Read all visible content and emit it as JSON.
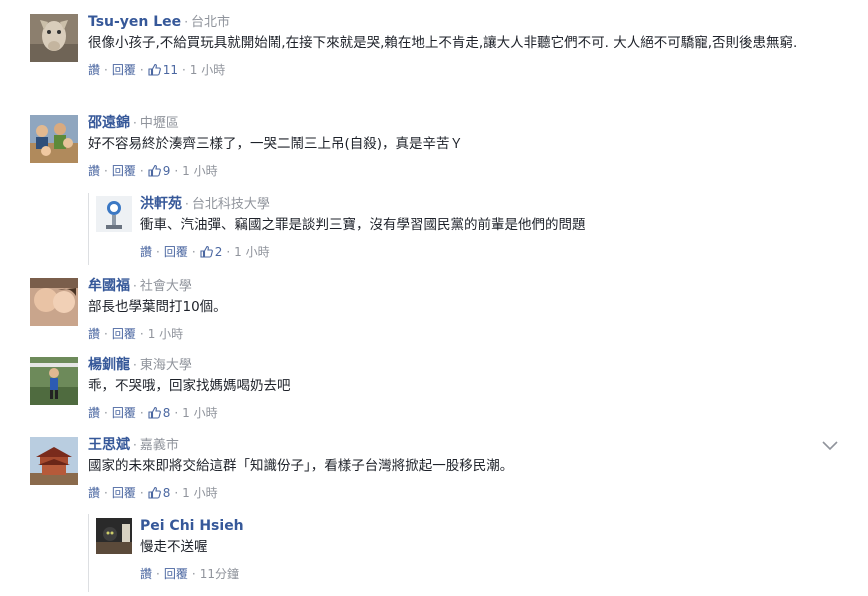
{
  "actions": {
    "like": "讚",
    "reply": "回覆",
    "separator": "·"
  },
  "comments": [
    {
      "name": "Tsu-yen Lee",
      "affiliation": "台北市",
      "text": "很像小孩子,不給買玩具就開始鬧,在接下來就是哭,賴在地上不肯走,讓大人非聽它們不可. 大人絕不可驕寵,否則後患無窮.",
      "likes": "11",
      "time": "1 小時"
    },
    {
      "name": "邵遠錦",
      "affiliation": "中壢區",
      "text": "好不容易終於湊齊三樣了，一哭二鬧三上吊(自殺)，真是辛苦Ｙ",
      "likes": "9",
      "time": "1 小時"
    },
    {
      "name": "洪軒苑",
      "affiliation": "台北科技大學",
      "text": "衝車、汽油彈、竊國之罪是談判三寶，沒有學習國民黨的前輩是他們的問題",
      "likes": "2",
      "time": "1 小時"
    },
    {
      "name": "牟國福",
      "affiliation": "社會大學",
      "text": "部長也學葉問打10個。",
      "likes": "",
      "time": "1 小時"
    },
    {
      "name": "楊釧龍",
      "affiliation": "東海大學",
      "text": "乖，不哭哦，回家找媽媽喝奶去吧",
      "likes": "8",
      "time": "1 小時"
    },
    {
      "name": "王思斌",
      "affiliation": "嘉義市",
      "text": "國家的未來即將交給這群「知識份子」，看樣子台灣將掀起一股移民潮。",
      "likes": "8",
      "time": "1 小時"
    },
    {
      "name": "Pei Chi Hsieh",
      "affiliation": "",
      "text": "慢走不送喔",
      "likes": "",
      "time": "11分鐘"
    }
  ],
  "icons": {
    "like": "thumbs-up-icon",
    "menu": "chevron-down-icon"
  },
  "colors": {
    "name": "#365899",
    "link": "#4b67a1",
    "meta": "#90949c",
    "text": "#1d2129"
  }
}
